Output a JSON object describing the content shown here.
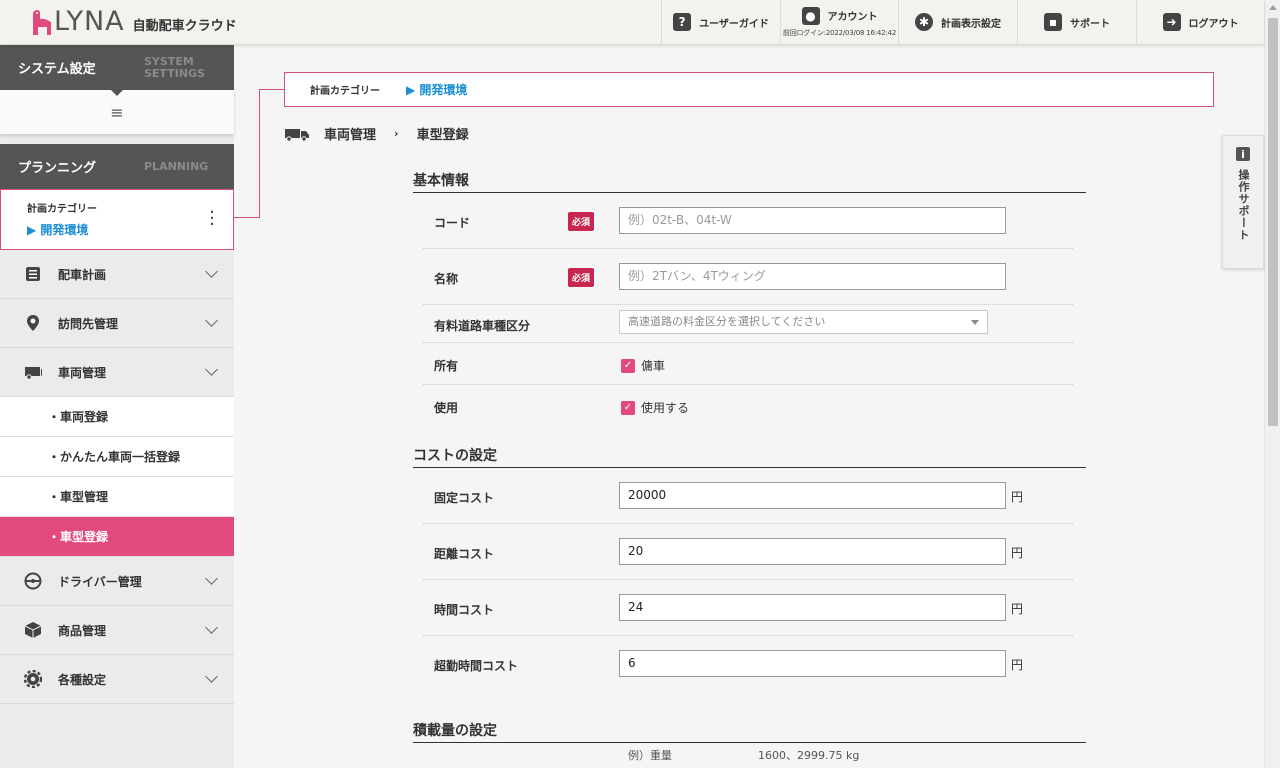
{
  "header": {
    "logo_text": "LYNA",
    "app_name": "自動配車クラウド",
    "nav": {
      "guide": "ユーザーガイド",
      "account": "アカウント",
      "last_login": "前回ログイン:2022/03/08 16:42:42",
      "plan_display": "計画表示設定",
      "support": "サポート",
      "logout": "ログアウト"
    }
  },
  "sidebar": {
    "system": {
      "ja": "システム設定",
      "en": "SYSTEM SETTINGS"
    },
    "planning": {
      "ja": "プランニング",
      "en": "PLANNING"
    },
    "category": {
      "label": "計画カテゴリー",
      "value": "▶ 開発環境"
    },
    "items": [
      {
        "label": "配車計画",
        "icon": "list-icon"
      },
      {
        "label": "訪問先管理",
        "icon": "map-pin-icon"
      },
      {
        "label": "車両管理",
        "icon": "truck-icon"
      }
    ],
    "sub_items": [
      {
        "label": "・車両登録"
      },
      {
        "label": "・かんたん車両一括登録"
      },
      {
        "label": "・車型管理"
      },
      {
        "label": "・車型登録"
      }
    ],
    "items2": [
      {
        "label": "ドライバー管理",
        "icon": "steering-wheel-icon"
      },
      {
        "label": "商品管理",
        "icon": "box-icon"
      },
      {
        "label": "各種設定",
        "icon": "gear-icon"
      }
    ]
  },
  "main": {
    "category": {
      "label": "計画カテゴリー",
      "value": "▶ 開発環境"
    },
    "breadcrumb": {
      "section": "車両管理",
      "sep": "›",
      "page": "車型登録"
    },
    "basic": {
      "title": "基本情報",
      "code": {
        "label": "コード",
        "req": "必須",
        "placeholder": "例）02t-B、04t-W"
      },
      "name": {
        "label": "名称",
        "req": "必須",
        "placeholder": "例）2Tバン、4Tウィング"
      },
      "toll": {
        "label": "有料道路車種区分",
        "placeholder": "高速道路の料金区分を選択してください"
      },
      "owned": {
        "label": "所有",
        "option": "傭車"
      },
      "usage": {
        "label": "使用",
        "option": "使用する"
      }
    },
    "cost": {
      "title": "コストの設定",
      "fixed": {
        "label": "固定コスト",
        "value": "20000",
        "unit": "円"
      },
      "distance": {
        "label": "距離コスト",
        "value": "20",
        "unit": "円"
      },
      "time": {
        "label": "時間コスト",
        "value": "24",
        "unit": "円"
      },
      "overtime": {
        "label": "超勤時間コスト",
        "value": "6",
        "unit": "円"
      }
    },
    "load": {
      "title": "積載量の設定",
      "ex_label": "例）重量",
      "ex_value": "1600、2999.75 kg"
    }
  },
  "help": {
    "text": "操作サポート",
    "icon_label": "i"
  }
}
